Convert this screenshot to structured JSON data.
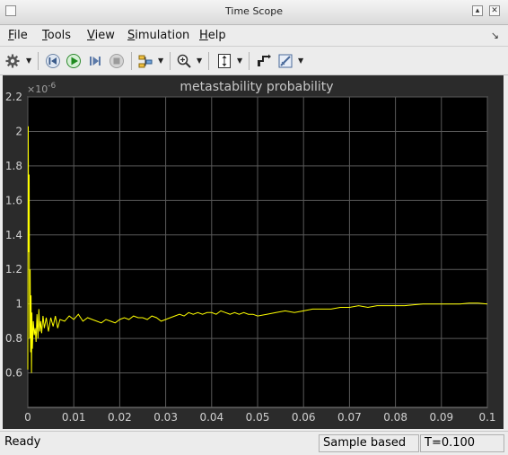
{
  "window": {
    "title": "Time Scope"
  },
  "menu": [
    {
      "label": "File",
      "underline": "F",
      "rest": "ile"
    },
    {
      "label": "Tools",
      "underline": "T",
      "rest": "ools"
    },
    {
      "label": "View",
      "underline": "V",
      "rest": "iew"
    },
    {
      "label": "Simulation",
      "underline": "S",
      "rest": "imulation"
    },
    {
      "label": "Help",
      "underline": "H",
      "rest": "elp"
    }
  ],
  "toolbar": {
    "icons": [
      "gear-icon",
      "step-back-icon",
      "run-icon",
      "step-forward-icon",
      "stop-icon",
      "signal-highlight-icon",
      "zoom-in-icon",
      "autoscale-icon",
      "restore-view-icon",
      "edit-properties-icon"
    ]
  },
  "status": {
    "ready": "Ready",
    "mode": "Sample based",
    "time": "T=0.100"
  },
  "colors": {
    "trace": "#ffff00",
    "plot_bg": "#000000",
    "frame_bg": "#2b2b2b",
    "grid": "#5a5a5a",
    "tick_text": "#d0d0d0"
  },
  "chart_data": {
    "type": "line",
    "title": "metastability probability",
    "exponent_label": "×10",
    "exponent": "-6",
    "xlabel": "",
    "ylabel": "",
    "xlim": [
      0,
      0.1
    ],
    "ylim": [
      0.4,
      2.2
    ],
    "xticks": [
      0,
      0.01,
      0.02,
      0.03,
      0.04,
      0.05,
      0.06,
      0.07,
      0.08,
      0.09,
      0.1
    ],
    "xtick_labels": [
      "0",
      "0.01",
      "0.02",
      "0.03",
      "0.04",
      "0.05",
      "0.06",
      "0.07",
      "0.08",
      "0.09",
      "0.1"
    ],
    "yticks": [
      0.6,
      0.8,
      1,
      1.2,
      1.4,
      1.6,
      1.8,
      2,
      2.2
    ],
    "ytick_labels": [
      "0.6",
      "0.8",
      "1",
      "1.2",
      "1.4",
      "1.6",
      "1.8",
      "2",
      "2.2"
    ],
    "grid": true,
    "series": [
      {
        "x": [
          0,
          0.0001,
          0.0002,
          0.0003,
          0.0004,
          0.0005,
          0.0006,
          0.0007,
          0.0008,
          0.0009,
          0.001,
          0.0012,
          0.0014,
          0.0016,
          0.0018,
          0.002,
          0.0022,
          0.0024,
          0.0026,
          0.0028,
          0.003,
          0.0033,
          0.0036,
          0.004,
          0.0045,
          0.005,
          0.0055,
          0.006,
          0.0065,
          0.007,
          0.008,
          0.009,
          0.01,
          0.011,
          0.012,
          0.013,
          0.014,
          0.015,
          0.016,
          0.017,
          0.018,
          0.019,
          0.02,
          0.021,
          0.022,
          0.023,
          0.024,
          0.025,
          0.026,
          0.027,
          0.028,
          0.029,
          0.03,
          0.031,
          0.032,
          0.033,
          0.034,
          0.035,
          0.036,
          0.037,
          0.038,
          0.039,
          0.04,
          0.041,
          0.042,
          0.043,
          0.044,
          0.045,
          0.046,
          0.047,
          0.048,
          0.049,
          0.05,
          0.052,
          0.054,
          0.056,
          0.058,
          0.06,
          0.062,
          0.064,
          0.066,
          0.068,
          0.07,
          0.072,
          0.074,
          0.076,
          0.078,
          0.08,
          0.082,
          0.084,
          0.086,
          0.088,
          0.09,
          0.092,
          0.094,
          0.096,
          0.098,
          0.1
        ],
        "y": [
          0.62,
          2.03,
          1.3,
          1.75,
          0.8,
          1.2,
          0.72,
          1.05,
          0.6,
          0.95,
          0.74,
          0.9,
          0.82,
          0.86,
          0.78,
          0.94,
          0.8,
          0.97,
          0.84,
          0.9,
          0.83,
          0.93,
          0.86,
          0.92,
          0.84,
          0.92,
          0.87,
          0.93,
          0.86,
          0.91,
          0.9,
          0.93,
          0.91,
          0.94,
          0.9,
          0.92,
          0.91,
          0.9,
          0.89,
          0.91,
          0.9,
          0.89,
          0.91,
          0.92,
          0.91,
          0.93,
          0.92,
          0.92,
          0.91,
          0.93,
          0.92,
          0.9,
          0.91,
          0.92,
          0.93,
          0.94,
          0.93,
          0.95,
          0.94,
          0.95,
          0.94,
          0.95,
          0.95,
          0.94,
          0.96,
          0.95,
          0.94,
          0.95,
          0.94,
          0.95,
          0.94,
          0.94,
          0.93,
          0.94,
          0.95,
          0.96,
          0.95,
          0.96,
          0.97,
          0.97,
          0.97,
          0.98,
          0.98,
          0.99,
          0.98,
          0.99,
          0.99,
          0.99,
          0.99,
          0.995,
          1.0,
          1.0,
          1.0,
          1.0,
          1.0,
          1.005,
          1.005,
          1.0
        ]
      }
    ]
  }
}
